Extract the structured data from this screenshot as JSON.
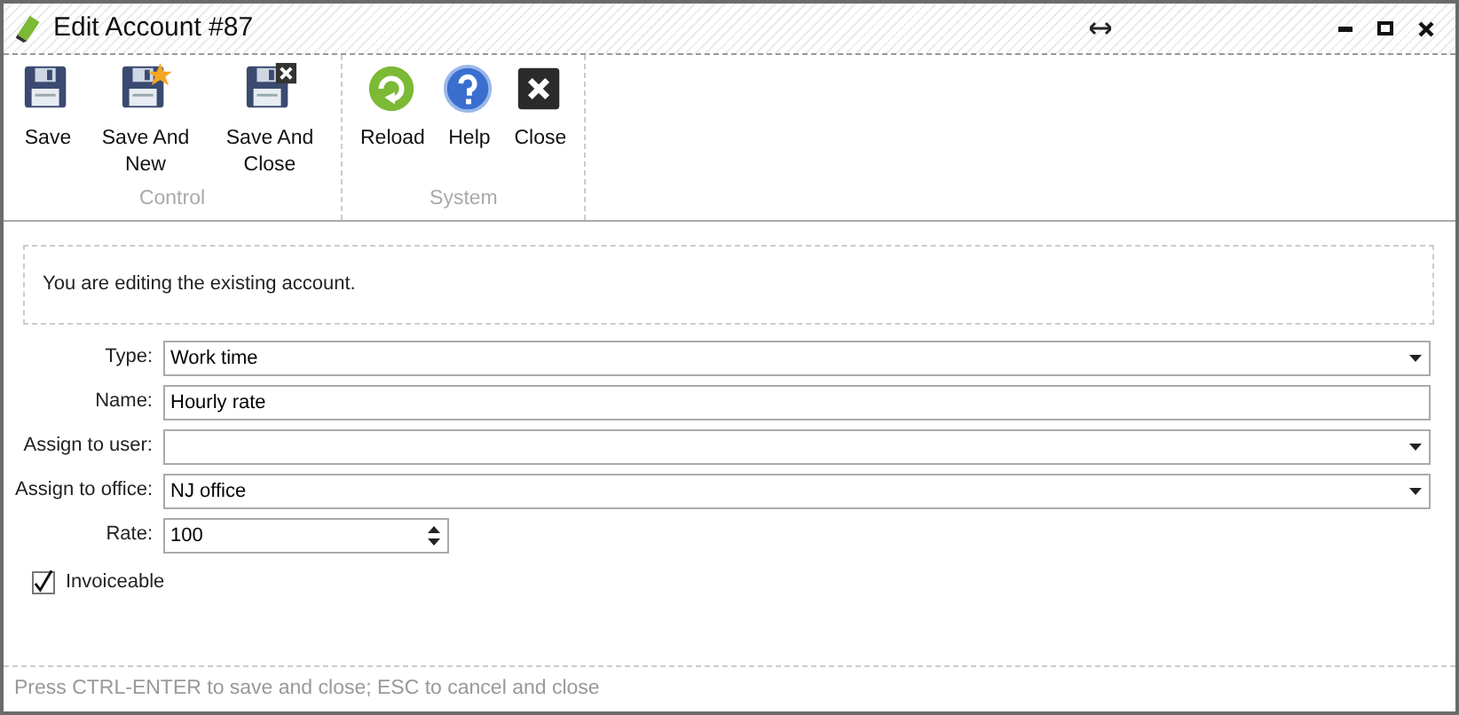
{
  "window": {
    "title": "Edit Account #87"
  },
  "toolbar_groups": [
    {
      "label": "Control",
      "buttons": [
        {
          "label": "Save",
          "kind": "save"
        },
        {
          "label": "Save And New",
          "kind": "savenew"
        },
        {
          "label": "Save And Close",
          "kind": "saveclose"
        }
      ]
    },
    {
      "label": "System",
      "buttons": [
        {
          "label": "Reload",
          "kind": "reload"
        },
        {
          "label": "Help",
          "kind": "help"
        },
        {
          "label": "Close",
          "kind": "close"
        }
      ]
    }
  ],
  "info": "You are editing the existing account.",
  "fields": [
    {
      "label": "Type:",
      "kind": "select",
      "value": "Work time"
    },
    {
      "label": "Name:",
      "kind": "text",
      "value": "Hourly rate"
    },
    {
      "label": "Assign to user:",
      "kind": "select"
    },
    {
      "label": "Assign to office:",
      "kind": "select",
      "value": "NJ office"
    },
    {
      "label": "Rate:",
      "kind": "number",
      "value": "100"
    }
  ],
  "invoiceable": {
    "label": "Invoiceable",
    "checked": true
  },
  "status_bar": "Press CTRL-ENTER to save and close; ESC to cancel and close"
}
